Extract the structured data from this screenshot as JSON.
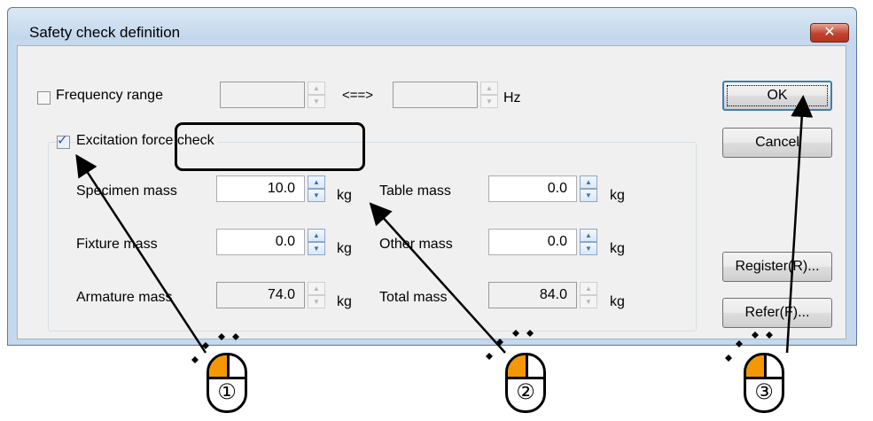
{
  "dialog": {
    "title": "Safety check definition",
    "close_glyph": "✕"
  },
  "frequency": {
    "checkbox_label": "Frequency range",
    "checked": false,
    "from_value": "",
    "separator": "<==>",
    "to_value": "",
    "unit": "Hz"
  },
  "excitation": {
    "checkbox_label": "Excitation force check",
    "checked": true,
    "fields": {
      "specimen_mass": {
        "label": "Specimen mass",
        "value": "10.0",
        "unit": "kg"
      },
      "table_mass": {
        "label": "Table mass",
        "value": "0.0",
        "unit": "kg"
      },
      "fixture_mass": {
        "label": "Fixture  mass",
        "value": "0.0",
        "unit": "kg"
      },
      "other_mass": {
        "label": "Other mass",
        "value": "0.0",
        "unit": "kg"
      },
      "armature_mass": {
        "label": "Armature mass",
        "value": "74.0",
        "unit": "kg"
      },
      "total_mass": {
        "label": "Total mass",
        "value": "84.0",
        "unit": "kg"
      }
    }
  },
  "buttons": {
    "ok": "OK",
    "cancel": "Cancel",
    "register": "Register(R)...",
    "refer": "Refer(F)..."
  },
  "annotations": {
    "step1": "①",
    "step2": "②",
    "step3": "③",
    "accent_color": "#f39800"
  },
  "icons": [
    "checkbox-icon",
    "spin-up-icon",
    "spin-down-icon",
    "close-icon",
    "mouse-click-icon",
    "arrow-icon"
  ]
}
